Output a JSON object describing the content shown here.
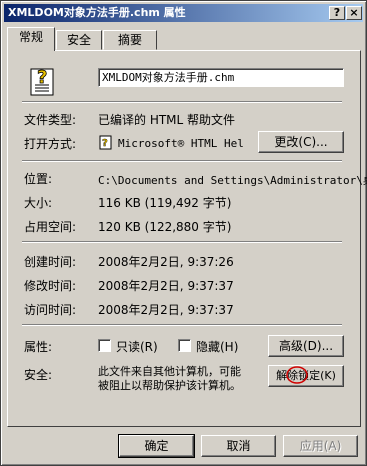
{
  "window": {
    "title": "XMLDOM对象方法手册.chm 属性",
    "help_btn": "?",
    "close_btn": "×"
  },
  "tabs": [
    {
      "label": "常规",
      "active": true
    },
    {
      "label": "安全",
      "active": false
    },
    {
      "label": "摘要",
      "active": false
    }
  ],
  "general": {
    "file_name": "XMLDOM对象方法手册.chm",
    "file_type_label": "文件类型:",
    "file_type_value": "已编译的 HTML 帮助文件",
    "open_with_label": "打开方式:",
    "open_with_value": "Microsoft® HTML Hel",
    "change_button": "更改(C)...",
    "location_label": "位置:",
    "location_value": "C:\\Documents and Settings\\Administrator\\桌",
    "size_label": "大小:",
    "size_value": "116 KB (119,492 字节)",
    "disk_size_label": "占用空间:",
    "disk_size_value": "120 KB (122,880 字节)",
    "created_label": "创建时间:",
    "created_value": "2008年2月2日, 9:37:26",
    "modified_label": "修改时间:",
    "modified_value": "2008年2月2日, 9:37:37",
    "accessed_label": "访问时间:",
    "accessed_value": "2008年2月2日, 9:37:37",
    "attributes_label": "属性:",
    "readonly_label": "只读(R)",
    "hidden_label": "隐藏(H)",
    "advanced_button": "高级(D)...",
    "security_label": "安全:",
    "security_text_1": "此文件来自其他计算机，可能",
    "security_text_2": "被阻止以帮助保护该计算机。",
    "unblock_button": "解除锁定(K)"
  },
  "footer": {
    "ok": "确定",
    "cancel": "取消",
    "apply": "应用(A)"
  }
}
